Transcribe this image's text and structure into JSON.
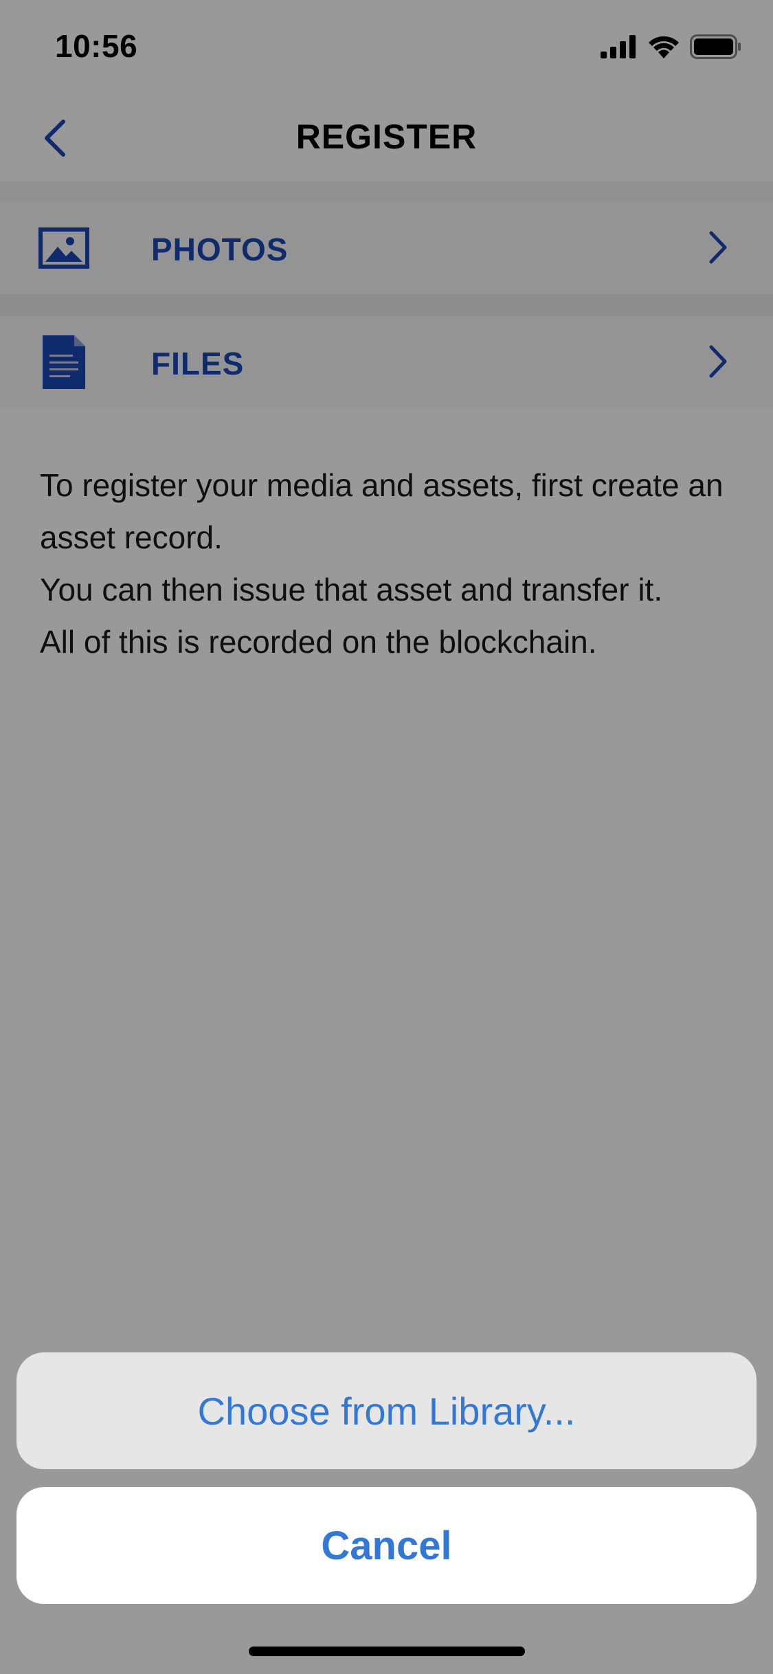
{
  "status_bar": {
    "time": "10:56",
    "icons": [
      "cellular-signal-icon",
      "wifi-icon",
      "battery-icon"
    ]
  },
  "nav": {
    "title": "REGISTER",
    "back_icon": "chevron-left-icon"
  },
  "rows": [
    {
      "label": "PHOTOS",
      "icon": "image-icon",
      "trailing_icon": "chevron-right-icon"
    },
    {
      "label": "FILES",
      "icon": "document-icon",
      "trailing_icon": "chevron-right-icon"
    }
  ],
  "description": {
    "line1": "To register your media and assets, first create an asset record.",
    "line2": "You can then issue that asset and transfer it.",
    "line3": "All of this is recorded on the blockchain."
  },
  "action_sheet": {
    "action_label": "Choose from Library...",
    "cancel_label": "Cancel"
  },
  "colors": {
    "accent_blue": "#1c47b8",
    "action_blue": "#3478d6",
    "overlay": "#000000"
  }
}
